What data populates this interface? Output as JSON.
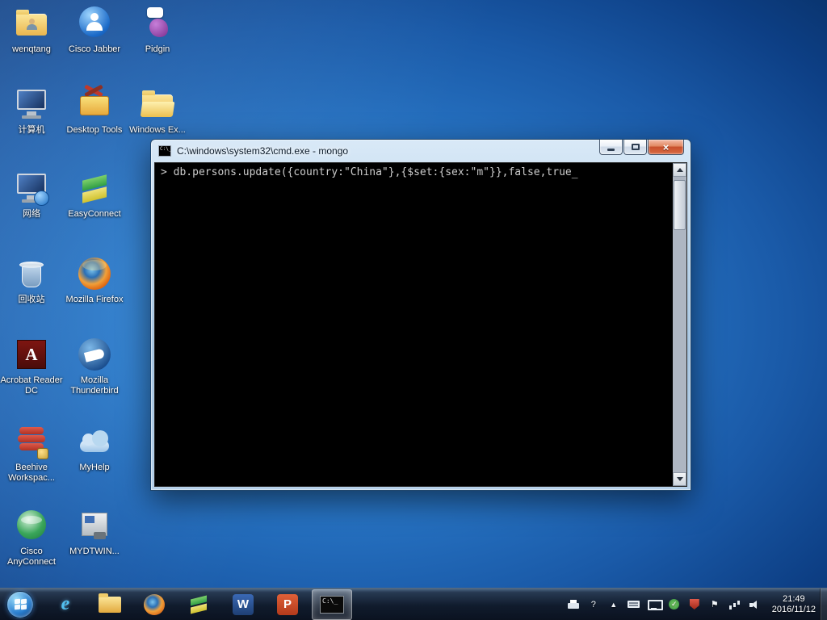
{
  "desktop": {
    "icons": [
      {
        "label": "wenqtang",
        "icon": "user-folder-icon"
      },
      {
        "label": "计算机",
        "icon": "computer-icon"
      },
      {
        "label": "网络",
        "icon": "network-icon"
      },
      {
        "label": "回收站",
        "icon": "recycle-bin-icon"
      },
      {
        "label": "Acrobat Reader DC",
        "icon": "acrobat-icon"
      },
      {
        "label": "Beehive Workspac...",
        "icon": "beehive-icon"
      },
      {
        "label": "Cisco AnyConnect",
        "icon": "anyconnect-icon"
      },
      {
        "label": "Cisco Jabber",
        "icon": "jabber-icon"
      },
      {
        "label": "Desktop Tools",
        "icon": "toolbox-icon"
      },
      {
        "label": "EasyConnect",
        "icon": "easyconnect-icon"
      },
      {
        "label": "Mozilla Firefox",
        "icon": "firefox-icon"
      },
      {
        "label": "Mozilla Thunderbird",
        "icon": "thunderbird-icon"
      },
      {
        "label": "MyHelp",
        "icon": "cloud-icon"
      },
      {
        "label": "MYDTWIN...",
        "icon": "installer-icon"
      },
      {
        "label": "Pidgin",
        "icon": "pidgin-icon"
      },
      {
        "label": "Windows Ex...",
        "icon": "explorer-folder-icon"
      }
    ]
  },
  "window": {
    "title": "C:\\windows\\system32\\cmd.exe - mongo",
    "console": {
      "prompt_line": "> db.persons.update({country:\"China\"},{$set:{sex:\"m\"}},false,true",
      "cursor": "_"
    }
  },
  "taskbar": {
    "buttons": [
      "internet-explorer",
      "windows-explorer",
      "firefox",
      "easyconnect",
      "word",
      "powerpoint",
      "cmd"
    ],
    "active_button": "cmd",
    "tray": {
      "help_glyph": "?",
      "chevron_glyph": "▲",
      "flag_glyph": "⚑",
      "check_glyph": "✓"
    },
    "clock": {
      "time": "21:49",
      "date": "2016/11/12"
    }
  },
  "colors": {
    "desktop_blue": "#2a79c9",
    "titlebar_glass": "#bcd6ec",
    "console_black": "#000000",
    "close_red": "#c8502c"
  }
}
